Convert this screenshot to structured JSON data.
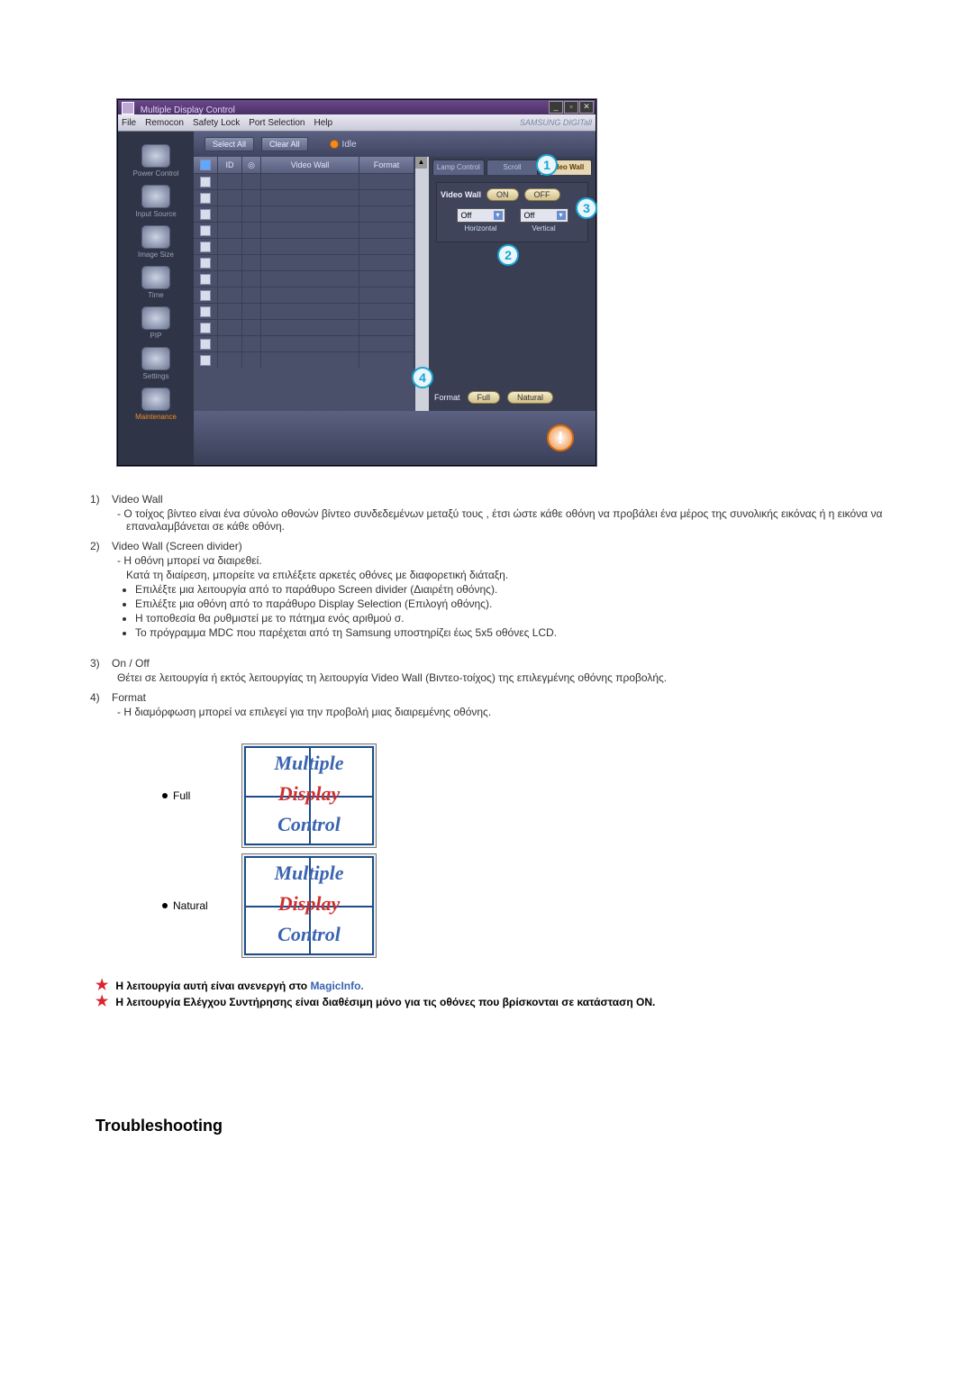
{
  "window": {
    "title": "Multiple Display Control",
    "menu": [
      "File",
      "Remocon",
      "Safety Lock",
      "Port Selection",
      "Help"
    ],
    "brand": "SAMSUNG DIGITall"
  },
  "toolbar": {
    "select_all": "Select All",
    "clear_all": "Clear All",
    "idle": "Idle"
  },
  "grid": {
    "headers": {
      "id": "ID",
      "video_wall": "Video Wall",
      "format": "Format"
    }
  },
  "sidebar": {
    "items": [
      {
        "label": "Power Control"
      },
      {
        "label": "Input Source"
      },
      {
        "label": "Image Size"
      },
      {
        "label": "Time"
      },
      {
        "label": "PIP"
      },
      {
        "label": "Settings"
      },
      {
        "label": "Maintenance"
      }
    ]
  },
  "tabs": {
    "lamp": "Lamp Control",
    "scroll": "Scroll",
    "video": "Video Wall"
  },
  "panel": {
    "video_wall_label": "Video Wall",
    "on": "ON",
    "off": "OFF",
    "h_value": "Off",
    "v_value": "Off",
    "h_label": "Horizontal",
    "v_label": "Vertical",
    "format_label": "Format",
    "full": "Full",
    "natural": "Natural"
  },
  "callouts": {
    "c1": "1",
    "c2": "2",
    "c3": "3",
    "c4": "4"
  },
  "explain": {
    "i1": {
      "num": "1)",
      "title": "Video Wall",
      "line": "- Ο τοίχος βίντεο είναι ένα σύνολο οθονών βίντεο συνδεδεμένων μεταξύ τους , έτσι ώστε κάθε οθόνη να προβάλει ένα μέρος της συνολικής εικόνας ή η εικόνα να επαναλαμβάνεται σε κάθε οθόνη."
    },
    "i2": {
      "num": "2)",
      "title": "Video Wall (Screen divider)",
      "l1": "- Η οθόνη μπορεί να διαιρεθεί.",
      "l2": "Κατά τη διαίρεση, μπορείτε να επιλέξετε αρκετές οθόνες με διαφορετική διάταξη.",
      "b1": "Επιλέξτε μια λειτουργία από το παράθυρο Screen divider (Διαιρέτη οθόνης).",
      "b2": "Επιλέξτε μια οθόνη από το παράθυρο Display Selection (Επιλογή οθόνης).",
      "b3": "Η τοποθεσία θα ρυθμιστεί με το πάτημα ενός αριθμού σ.",
      "b4": "Το πρόγραμμα MDC που παρέχεται από τη Samsung υποστηρίζει έως 5x5 οθόνες LCD."
    },
    "i3": {
      "num": "3)",
      "title": "On / Off",
      "line": "Θέτει σε λειτουργία ή εκτός λειτουργίας τη λειτουργία Video Wall (Βιντεο-τοίχος) της επιλεγμένης οθόνης προβολής."
    },
    "i4": {
      "num": "4)",
      "title": "Format",
      "line": "- Η διαμόρφωση μπορεί να επιλεγεί για την προβολή μιας διαιρεμένης οθόνης."
    }
  },
  "thumbs": {
    "full": "Full",
    "natural": "Natural",
    "line1": "Multiple",
    "line2": "Display",
    "line3": "Control"
  },
  "notes": {
    "n1a": "Η λειτουργία αυτή είναι ανενεργή στο ",
    "n1b": "MagicInfo.",
    "n2": "Η λειτουργία Ελέγχου Συντήρησης είναι διαθέσιμη μόνο για τις οθόνες που βρίσκονται σε κατάσταση ON."
  },
  "heading": "Troubleshooting"
}
